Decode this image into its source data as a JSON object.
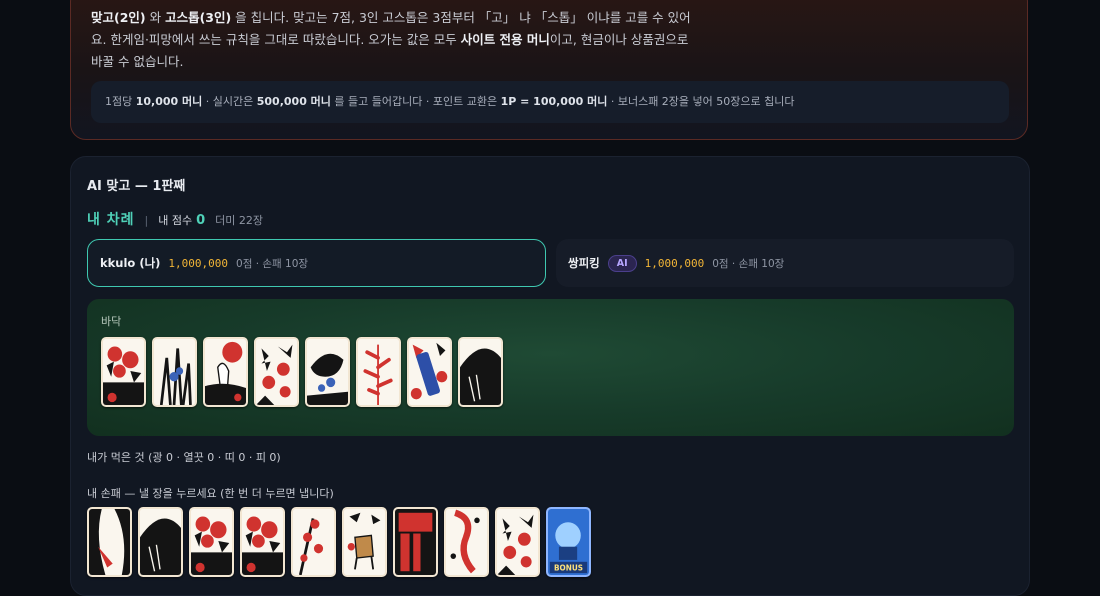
{
  "intro": {
    "line1_parts": [
      "맞고(2인)",
      " 와 ",
      "고스톱(3인)",
      " 을 칩니다. 맞고는 7점, 3인 고스톱은 3점부터 「고」 냐 「스톱」 이냐를 고를 수 있어"
    ],
    "line2_parts": [
      "요. 한게임·피망에서 쓰는 규칙을 그대로 따랐습니다. 오가는 값은 모두 ",
      "사이트 전용 머니",
      "이고, 현금이나 상품권으로"
    ],
    "line3": "바꿀 수 없습니다.",
    "rules_strip": {
      "p1": "1점당 ",
      "v1": "10,000 머니",
      "p2": " · 실시간은 ",
      "v2": "500,000 머니",
      "p3": " 를 들고 들어갑니다 · 포인트 교환은 ",
      "v3": "1P = 100,000 머니",
      "p4": " · 보너스패 2장을 넣어 50장으로 칩니다"
    }
  },
  "game": {
    "title": "AI 맞고 — 1판째",
    "turn_label": "내 차례",
    "turn_sep": "|",
    "score_label": "내 점수",
    "score_value": "0",
    "deck_count": "더미 22장",
    "player_me": {
      "name": "kkulo (나)",
      "money": "1,000,000",
      "meta": "0점 · 손패 10장"
    },
    "player_ai": {
      "name": "쌍피킹",
      "badge": "AI",
      "money": "1,000,000",
      "meta": "0점 · 손패 10장"
    },
    "board_label": "바닥",
    "board_cards": [
      "peony-card",
      "iris-card",
      "crane-card",
      "maple-card",
      "bushclover-card",
      "bushclover-ribbon-card",
      "maple-ribbon-card",
      "pampas-card"
    ],
    "captured_text": "내가 먹은 것 (광 0 · 열끗 0 · 띠 0 · 피 0)",
    "hand_label": "내 손패 — 낼 장을 누르세요 (한 번 더 누르면 냅니다)",
    "hand_cards": [
      "willow-card",
      "pampas-card",
      "peony-card",
      "peony-card",
      "plum-card",
      "deer-card",
      "paulownia-card",
      "wisteria-card",
      "maple-card",
      "bonus-card"
    ],
    "bonus_text": "BONUS"
  },
  "colors": {
    "accent": "#4fd1b8",
    "money": "#f0b437",
    "card_red": "#d0332f",
    "card_black": "#141414"
  }
}
